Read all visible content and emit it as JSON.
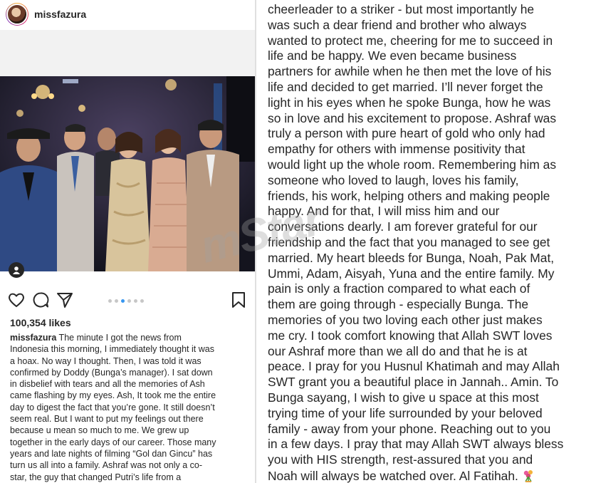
{
  "post": {
    "username": "missfazura",
    "likes": "100,354 likes",
    "caption_user": "missfazura",
    "caption_text": " The minute I got the news from\nIndonesia this morning, I immediately thought it was\na hoax. No way I thought. Then, I was told it was\nconfirmed by Doddy (Bunga’s manager). I sat down\nin disbelief with tears and all the memories of Ash\ncame flashing by my eyes. Ash, It took me the entire\nday to digest the fact that you’re gone. It still doesn’t\nseem real. But I want to put my feelings out there\nbecause u mean so much to me. We grew up\ntogether in the early days of our career. Those many\nyears and late nights of filming “Gol dan Gincu” has\nturn us all into a family. Ashraf was not only a co-\nstar, the guy that changed Putri’s life from a",
    "carousel": {
      "count": 6,
      "active": 2
    }
  },
  "continued": {
    "text": "cheerleader to a striker - but most importantly he\nwas such a dear friend and brother who always\nwanted to protect me, cheering for me to succeed in\nlife and be happy. We even became business\npartners for awhile when he then met the love of his\nlife and decided to get married. I’ll never forget the\nlight in his eyes when he spoke Bunga, how he was\nso in love and his excitement to propose. Ashraf was\ntruly a person with pure heart of gold who only had\nempathy for others with immense positivity that\nwould light up the whole room. Remembering him as\nsomeone who loved to laugh, loves his family,\nfriends, his work, helping others and making people\nhappy. And for that, I will miss him and our\nconversations dearly. I am forever grateful for our\nfriendship and the fact that you managed to see get\nmarried. My heart bleeds for Bunga, Noah, Pak Mat,\nUmmi, Adam, Aisyah, Yuna and the entire family. My\npain is only a fraction compared to what each of\nthem are going through - especially Bunga. The\nmemories of you two loving each other just makes\nme cry. I took comfort knowing that Allah SWT loves\nour Ashraf more than we all do and that he is at\npeace. I pray for you Husnul Khatimah and may Allah\nSWT grant you a beautiful place in Jannah.. Amin. To\nBunga sayang, I wish to give u space at this most\ntrying time of your life surrounded by your beloved\nfamily - away from your phone. Reaching out to you\nin a few days. I pray that may Allah SWT always bless\nyou with HIS strength, rest-assured that you and\nNoah will always be watched over. Al Fatihah."
  },
  "watermark": "mStar",
  "icons": [
    "heart-icon",
    "comment-icon",
    "share-icon",
    "bookmark-icon",
    "user-tag-icon",
    "flower-emoji-icon"
  ],
  "colors": {
    "accent": "#3897f0",
    "text": "#262626"
  }
}
